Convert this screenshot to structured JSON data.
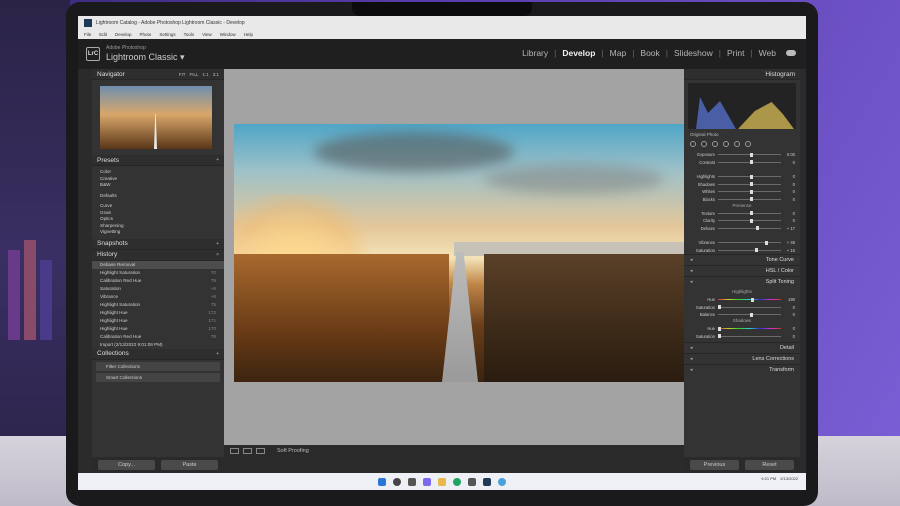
{
  "window": {
    "title": "Lightroom Catalog - Adobe Photoshop Lightroom Classic - Develop",
    "menu": [
      "File",
      "Edit",
      "Develop",
      "Photo",
      "Settings",
      "Tools",
      "View",
      "Window",
      "Help"
    ]
  },
  "app": {
    "logo_text": "LrC",
    "brand_small": "Adobe Photoshop",
    "brand_big": "Lightroom Classic ▾"
  },
  "modules": [
    {
      "label": "Library",
      "active": false
    },
    {
      "label": "Develop",
      "active": true
    },
    {
      "label": "Map",
      "active": false
    },
    {
      "label": "Book",
      "active": false
    },
    {
      "label": "Slideshow",
      "active": false
    },
    {
      "label": "Print",
      "active": false
    },
    {
      "label": "Web",
      "active": false
    }
  ],
  "left": {
    "navigator": {
      "title": "Navigator",
      "zoom": [
        "FIT",
        "FILL",
        "1:1",
        "3:1"
      ]
    },
    "presets": {
      "title": "Presets",
      "items": [
        "Color",
        "Creative",
        "B&W",
        "",
        "Defaults",
        "",
        "Curve",
        "Grain",
        "Optics",
        "Sharpening",
        "Vignetting"
      ]
    },
    "snapshots": {
      "title": "Snapshots"
    },
    "history": {
      "title": "History",
      "items": [
        {
          "label": "Debase Removal",
          "value": ""
        },
        {
          "label": "Highlight Saturation",
          "value": "70"
        },
        {
          "label": "Calibration Red Hue",
          "value": "79"
        },
        {
          "label": "Saturation",
          "value": "+6"
        },
        {
          "label": "Vibrance",
          "value": "+8"
        },
        {
          "label": "Highlight Saturation",
          "value": "75"
        },
        {
          "label": "Highlight Hue",
          "value": "172"
        },
        {
          "label": "Highlight Hue",
          "value": "171"
        },
        {
          "label": "Highlight Hue",
          "value": "170"
        },
        {
          "label": "Calibration Red Hue",
          "value": "79"
        },
        {
          "label": "Import (2/13/2022 9:01:09 PM)",
          "value": ""
        }
      ]
    },
    "collections": {
      "title": "Collections",
      "items": [
        "Filter Collections",
        "Smart Collections"
      ]
    },
    "copy_label": "Copy...",
    "paste_label": "Paste"
  },
  "toolbar": {
    "soft_proofing": "Soft Proofing"
  },
  "right": {
    "histogram_title": "Histogram",
    "original_photo": "Original Photo",
    "basic_sliders": [
      {
        "label": "Exposure",
        "value": "0.00",
        "pos": 0.5
      },
      {
        "label": "Contrast",
        "value": "0",
        "pos": 0.5
      },
      {
        "label": "",
        "value": "",
        "pos": null
      },
      {
        "label": "Highlights",
        "value": "0",
        "pos": 0.5
      },
      {
        "label": "Shadows",
        "value": "0",
        "pos": 0.5
      },
      {
        "label": "Whites",
        "value": "0",
        "pos": 0.5
      },
      {
        "label": "Blacks",
        "value": "0",
        "pos": 0.5
      }
    ],
    "presence_label": "Presence",
    "presence_sliders": [
      {
        "label": "Texture",
        "value": "0",
        "pos": 0.5
      },
      {
        "label": "Clarity",
        "value": "0",
        "pos": 0.5
      },
      {
        "label": "Dehaze",
        "value": "+ 17",
        "pos": 0.6
      },
      {
        "label": "",
        "value": "",
        "pos": null
      },
      {
        "label": "Vibrance",
        "value": "+ 48",
        "pos": 0.74
      },
      {
        "label": "Saturation",
        "value": "+ 15",
        "pos": 0.58
      }
    ],
    "sections": [
      "Tone Curve",
      "HSL / Color",
      "Split Toning"
    ],
    "split_toning": {
      "highlights_label": "Highlights",
      "hue_label": "Hue",
      "sat_label": "Saturation",
      "balance_label": "Balance",
      "shadows_label": "Shadows",
      "hl_hue": "190",
      "hl_sat": "0",
      "balance": "0",
      "sh_hue": "0",
      "sh_sat": "0"
    },
    "lower_sections": [
      "Detail",
      "Lens Corrections",
      "Transform"
    ],
    "previous_label": "Previous",
    "reset_label": "Reset"
  },
  "taskbar": {
    "time": "9:21 PM",
    "date": "2/13/2022"
  }
}
